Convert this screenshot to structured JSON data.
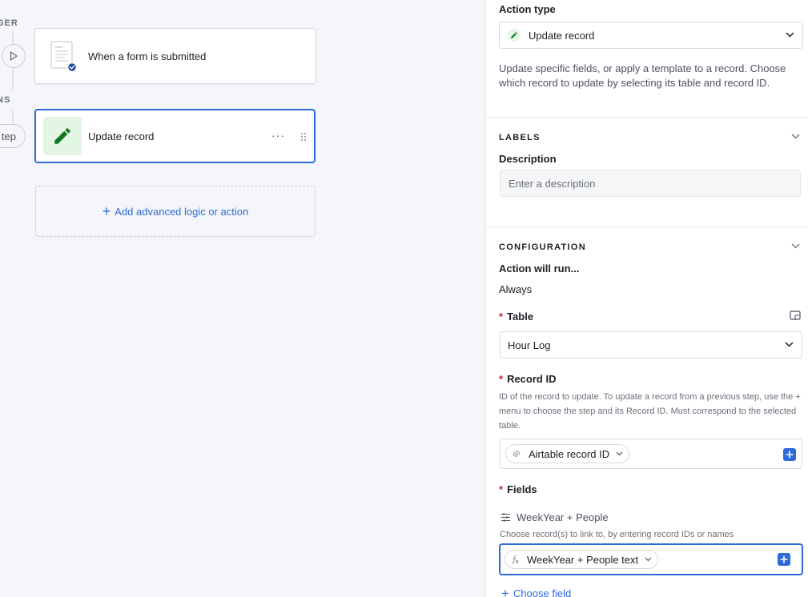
{
  "canvas": {
    "trigger_rail_label": "GER",
    "actions_rail_label": "NS",
    "step_pill_label": "tep",
    "trigger_card": {
      "title": "When a form is submitted"
    },
    "action_card": {
      "title": "Update record",
      "menu_glyph": "···"
    },
    "add_button": {
      "label": "Add advanced logic or action"
    }
  },
  "panel": {
    "action_type": {
      "label": "Action type",
      "value": "Update record",
      "description": "Update specific fields, or apply a template to a record. Choose which record to update by selecting its table and record ID."
    },
    "labels_section": {
      "heading": "LABELS",
      "description_label": "Description",
      "description_placeholder": "Enter a description",
      "description_value": ""
    },
    "configuration_section": {
      "heading": "CONFIGURATION",
      "run_label": "Action will run...",
      "run_value": "Always",
      "table": {
        "label": "Table",
        "value": "Hour Log"
      },
      "record_id": {
        "label": "Record ID",
        "help": "ID of the record to update. To update a record from a previous step, use the + menu to choose the step and its Record ID. Must correspond to the selected table.",
        "token": "Airtable record ID"
      },
      "fields": {
        "label": "Fields",
        "field_name": "WeekYear + People",
        "field_help": "Choose record(s) to link to, by entering record IDs or names",
        "token": "WeekYear + People text",
        "choose_field": "Choose field"
      }
    }
  },
  "colors": {
    "accent": "#2d6ad9",
    "required": "#c2282a",
    "action_icon_bg": "#e3f5e3",
    "action_icon_fg": "#0f7a1c",
    "canvas_bg": "#f5f6f9"
  }
}
